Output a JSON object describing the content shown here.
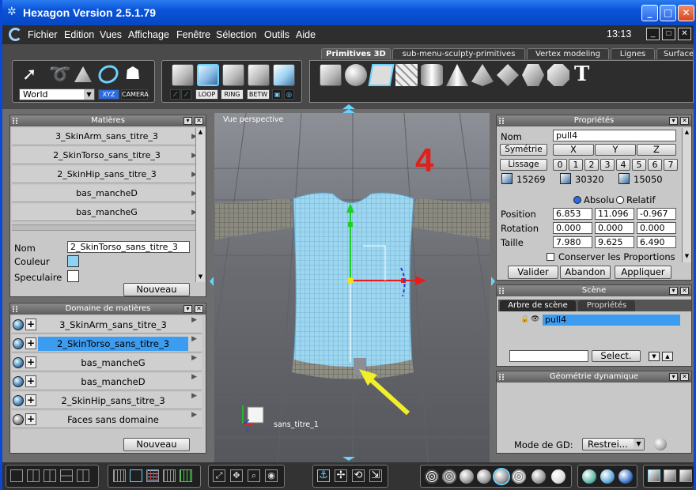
{
  "window": {
    "title": "Hexagon Version 2.5.1.79"
  },
  "menubar": {
    "items": [
      "Fichier",
      "Edition",
      "Vues",
      "Affichage",
      "Fenêtre",
      "Sélection",
      "Outils",
      "Aide"
    ],
    "clock": "13:13"
  },
  "toolbar": {
    "world_dropdown": "World",
    "xyz_label": "XYZ",
    "camera_label": "CAMERA",
    "loop_label": "LOOP",
    "ring_label": "RING",
    "betw_label": "BETW",
    "tabs": [
      "Primitives 3D",
      "sub-menu-sculpty-primitives",
      "Vertex modeling",
      "Lignes",
      "Surface"
    ]
  },
  "materials": {
    "title": "Matières",
    "items": [
      "3_SkinArm_sans_titre_3",
      "2_SkinTorso_sans_titre_3",
      "2_SkinHip_sans_titre_3",
      "bas_mancheD",
      "bas_mancheG"
    ],
    "nom_label": "Nom",
    "nom_value": "2_SkinTorso_sans_titre_3",
    "couleur_label": "Couleur",
    "speculaire_label": "Speculaire",
    "new_button": "Nouveau",
    "couleur_color": "#8fd3f4",
    "speculaire_color": "#ffffff"
  },
  "domains": {
    "title": "Domaine de matières",
    "items": [
      "3_SkinArm_sans_titre_3",
      "2_SkinTorso_sans_titre_3",
      "bas_mancheG",
      "bas_mancheD",
      "2_SkinHip_sans_titre_3",
      "Faces sans domaine"
    ],
    "selected_index": 1,
    "new_button": "Nouveau"
  },
  "viewport": {
    "label": "Vue perspective",
    "annotation": "4",
    "object_label": "sans_titre_1",
    "annotation_color": "#e0201c",
    "arrow_color": "#f2ee2a"
  },
  "properties": {
    "title": "Propriétés",
    "nom_label": "Nom",
    "nom_value": "pull4",
    "symetrie_label": "Symétrie",
    "axes": [
      "X",
      "Y",
      "Z"
    ],
    "lissage_label": "Lissage",
    "lissage_levels": [
      "0",
      "1",
      "2",
      "3",
      "4",
      "5",
      "6",
      "7"
    ],
    "counts": [
      "15269",
      "30320",
      "15050"
    ],
    "absolu_label": "Absolu",
    "relatif_label": "Relatif",
    "rows": [
      {
        "label": "Position",
        "values": [
          "6.853",
          "11.096",
          "-0.967"
        ]
      },
      {
        "label": "Rotation",
        "values": [
          "0.000",
          "0.000",
          "0.000"
        ]
      },
      {
        "label": "Taille",
        "values": [
          "7.980",
          "9.625",
          "6.490"
        ]
      }
    ],
    "keep_proportions_label": "Conserver les Proportions",
    "valider": "Valider",
    "abandon": "Abandon",
    "appliquer": "Appliquer"
  },
  "scene": {
    "title": "Scène",
    "tabs": [
      "Arbre de scène",
      "Propriétés"
    ],
    "item": "pull4",
    "select_button": "Select."
  },
  "dyn_geometry": {
    "title": "Géométrie dynamique",
    "mode_label": "Mode de GD:",
    "mode_value": "Restrei..."
  }
}
